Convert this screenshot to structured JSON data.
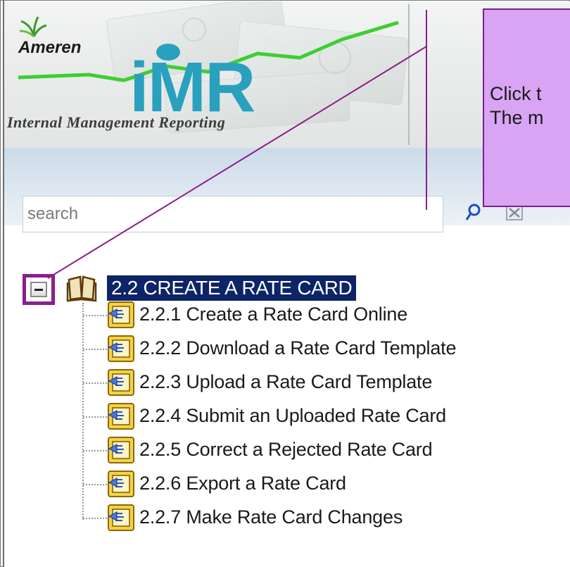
{
  "header": {
    "brand": "Ameren",
    "product": "iMR",
    "tagline": "Internal Management Reporting"
  },
  "search": {
    "placeholder": "search"
  },
  "tree": {
    "root_label": "2.2 CREATE A RATE CARD",
    "children": [
      {
        "label": "2.2.1 Create a Rate Card Online"
      },
      {
        "label": "2.2.2  Download a Rate Card Template"
      },
      {
        "label": "2.2.3  Upload a Rate Card Template"
      },
      {
        "label": "2.2.4  Submit an Uploaded Rate Card"
      },
      {
        "label": "2.2.5  Correct a Rejected Rate Card"
      },
      {
        "label": "2.2.6  Export a Rate Card"
      },
      {
        "label": "2.2.7  Make Rate Card Changes"
      }
    ]
  },
  "callout": {
    "line1": "Click t",
    "line2": "The m"
  },
  "colors": {
    "selection": "#0d2466",
    "callout_fill": "#d9a4f3",
    "callout_border": "#7b1f8f",
    "imr_blue": "#2aa0bf"
  }
}
